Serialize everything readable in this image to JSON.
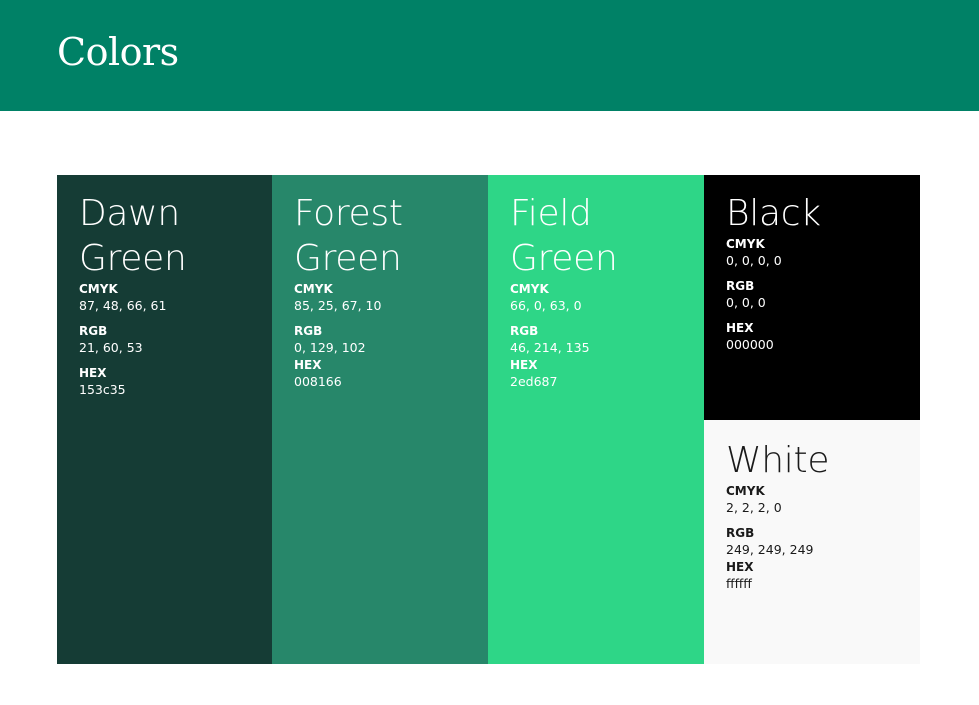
{
  "header": {
    "title": "Colors"
  },
  "colors": [
    {
      "name_lines": [
        "Dawn",
        "Green"
      ],
      "cmyk_label": "CMYK",
      "cmyk": "87, 48, 66, 61",
      "rgb_label": "RGB",
      "rgb": "21, 60, 53",
      "hex_label": "HEX",
      "hex": "153c35",
      "swatch_color": "#153c35"
    },
    {
      "name_lines": [
        "Forest",
        "Green"
      ],
      "cmyk_label": "CMYK",
      "cmyk": "85, 25, 67, 10",
      "rgb_label": "RGB",
      "rgb": "0, 129, 102",
      "hex_label": "HEX",
      "hex": "008166",
      "swatch_color": "#27876a"
    },
    {
      "name_lines": [
        "Field",
        "Green"
      ],
      "cmyk_label": "CMYK",
      "cmyk": "66, 0, 63, 0",
      "rgb_label": "RGB",
      "rgb": "46, 214, 135",
      "hex_label": "HEX",
      "hex": "2ed687",
      "swatch_color": "#2ed687"
    },
    {
      "name_lines": [
        "Black"
      ],
      "cmyk_label": "CMYK",
      "cmyk": "0, 0, 0, 0",
      "rgb_label": "RGB",
      "rgb": "0, 0, 0",
      "hex_label": "HEX",
      "hex": "000000",
      "swatch_color": "#000000"
    },
    {
      "name_lines": [
        "White"
      ],
      "cmyk_label": "CMYK",
      "cmyk": "2, 2, 2, 0",
      "rgb_label": "RGB",
      "rgb": "249, 249, 249",
      "hex_label": "HEX",
      "hex": "ffffff",
      "swatch_color": "#f9f9f9"
    }
  ]
}
